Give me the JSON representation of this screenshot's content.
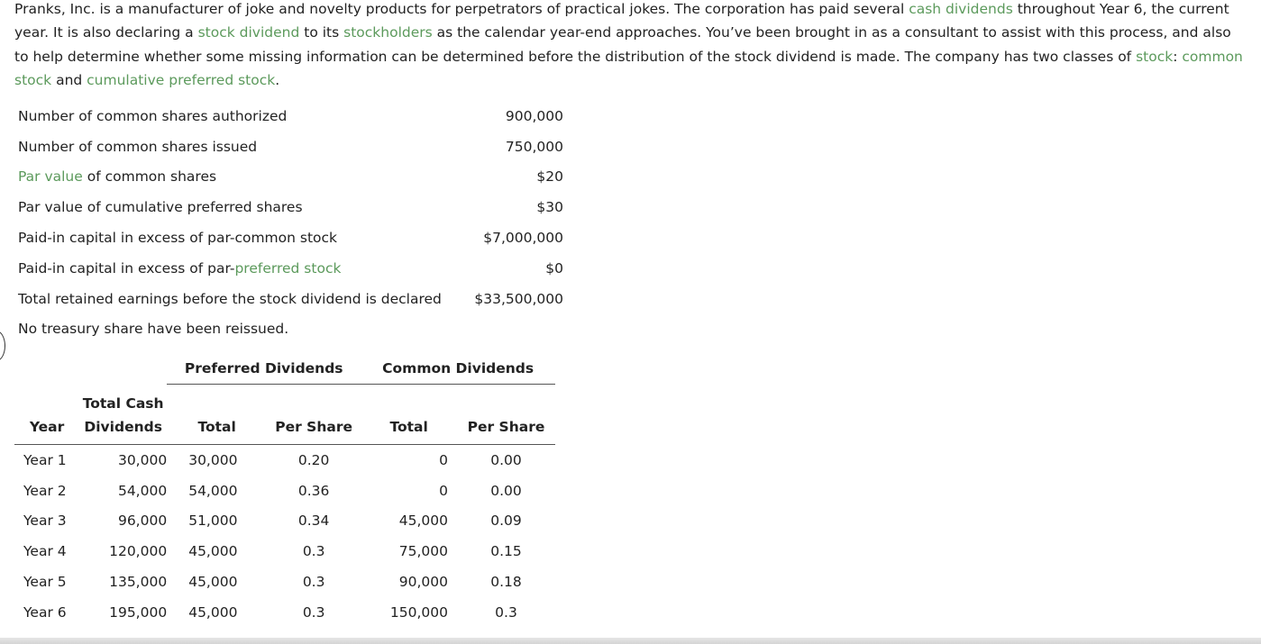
{
  "intro": {
    "s1": "Pranks, Inc. is a manufacturer of joke and novelty products for perpetrators of practical jokes. The corporation has paid several ",
    "t1": "cash dividends",
    "s2": " throughout Year 6, the current year. It is also declaring a ",
    "t2": "stock dividend",
    "s3": " to its ",
    "t3": "stockholders",
    "s4": " as the calendar year-end approaches. You’ve been brought in as a consultant to assist with this process, and also to help determine whether some missing information can be determined before the distribution of the stock dividend is made. The company has two classes of ",
    "t4": "stock",
    "s5": ": ",
    "t5": "common stock",
    "s6": " and ",
    "t6": "cumulative preferred stock",
    "s7": "."
  },
  "facts": {
    "r1": {
      "label": "Number of common shares authorized",
      "value": "900,000"
    },
    "r2": {
      "label": "Number of common shares issued",
      "value": "750,000"
    },
    "r3": {
      "term": "Par value",
      "label_rest": " of common shares",
      "value": "$20"
    },
    "r4": {
      "label": "Par value of cumulative preferred shares",
      "value": "$30"
    },
    "r5": {
      "label": "Paid-in capital in excess of par-common stock",
      "value": "$7,000,000"
    },
    "r6": {
      "label_pre": "Paid-in capital in excess of par-",
      "term": "preferred stock",
      "value": "$0"
    },
    "r7": {
      "label": "Total retained earnings before the stock dividend is declared",
      "value": "$33,500,000"
    },
    "r8": {
      "label": "No treasury share have been reissued."
    }
  },
  "dividends": {
    "group_preferred": "Preferred Dividends",
    "group_common": "Common Dividends",
    "col_year": "Year",
    "col_total_cash_1": "Total Cash",
    "col_total_cash_2": "Dividends",
    "col_pref_total": "Total",
    "col_pref_per_share": "Per Share",
    "col_common_total": "Total",
    "col_common_per_share": "Per Share",
    "rows": [
      {
        "year": "Year 1",
        "total_cash": "30,000",
        "pref_total": "30,000",
        "pref_ps": "0.20",
        "common_total": "0",
        "common_ps": "0.00"
      },
      {
        "year": "Year 2",
        "total_cash": "54,000",
        "pref_total": "54,000",
        "pref_ps": "0.36",
        "common_total": "0",
        "common_ps": "0.00"
      },
      {
        "year": "Year 3",
        "total_cash": "96,000",
        "pref_total": "51,000",
        "pref_ps": "0.34",
        "common_total": "45,000",
        "common_ps": "0.09"
      },
      {
        "year": "Year 4",
        "total_cash": "120,000",
        "pref_total": "45,000",
        "pref_ps": "0.3",
        "common_total": "75,000",
        "common_ps": "0.15"
      },
      {
        "year": "Year 5",
        "total_cash": "135,000",
        "pref_total": "45,000",
        "pref_ps": "0.3",
        "common_total": "90,000",
        "common_ps": "0.18"
      },
      {
        "year": "Year 6",
        "total_cash": "195,000",
        "pref_total": "45,000",
        "pref_ps": "0.3",
        "common_total": "150,000",
        "common_ps": "0.3"
      }
    ]
  },
  "colors": {
    "link_term": "#5c9a5c",
    "text": "#222222"
  }
}
